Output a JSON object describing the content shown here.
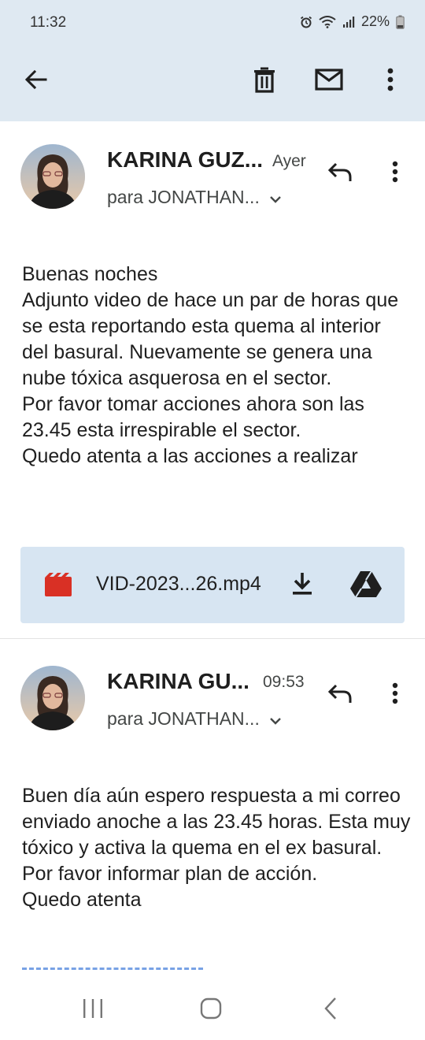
{
  "status_bar": {
    "time": "11:32",
    "battery": "22%",
    "icons": [
      "alarm-icon",
      "wifi-icon",
      "signal-icon",
      "battery-icon"
    ]
  },
  "toolbar": {
    "icons": [
      "back-arrow-icon",
      "trash-icon",
      "mail-icon",
      "more-vert-icon"
    ]
  },
  "messages": [
    {
      "sender": "KARINA GUZ...",
      "date": "Ayer",
      "recipient": "para JONATHAN...",
      "body": [
        "Buenas noches",
        "Adjunto video de hace un par de horas que se esta reportando esta quema al interior del basural. Nuevamente se genera una nube tóxica asquerosa en el sector.",
        "Por favor tomar acciones ahora son las 23.45 esta irrespirable el sector.",
        "Quedo atenta a las acciones a realizar"
      ],
      "attachment": {
        "name": "VID-2023...26.mp4",
        "icons": [
          "video-file-icon",
          "download-icon",
          "drive-icon"
        ]
      }
    },
    {
      "sender": "KARINA GU...",
      "date": "09:53",
      "recipient": "para JONATHAN...",
      "body": [
        "Buen día aún espero respuesta a mi correo enviado anoche a las 23.45 horas.  Esta muy tóxico y activa la quema en el ex basural.",
        "Por favor informar plan de acción.",
        "Quedo atenta"
      ]
    }
  ],
  "colors": {
    "app_bar_bg": "#dfe9f2",
    "attachment_bg": "#d7e5f2",
    "video_icon": "#d93025",
    "text_primary": "#1f1f1f",
    "text_secondary": "#444746"
  },
  "nav_bar": {
    "icons": [
      "recent-apps-icon",
      "home-icon",
      "back-nav-icon"
    ]
  }
}
